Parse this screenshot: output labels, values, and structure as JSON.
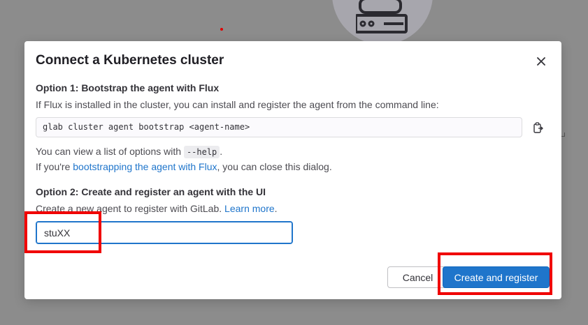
{
  "modal": {
    "title": "Connect a Kubernetes cluster",
    "close_icon": "close-icon",
    "option1": {
      "title": "Option 1: Bootstrap the agent with Flux",
      "description": "If Flux is installed in the cluster, you can install and register the agent from the command line:",
      "command": "glab cluster agent bootstrap <agent-name>",
      "copy_icon": "copy-to-clipboard-icon",
      "help_prefix": "You can view a list of options with ",
      "help_code": "--help",
      "help_suffix": ".",
      "flux_prefix": "If you're ",
      "flux_link": "bootstrapping the agent with Flux",
      "flux_suffix": ", you can close this dialog."
    },
    "option2": {
      "title": "Option 2: Create and register an agent with the UI",
      "description": "Create a new agent to register with GitLab. ",
      "learn_more": "Learn more",
      "learn_more_suffix": ".",
      "agent_name_value": "stuXX"
    },
    "buttons": {
      "cancel": "Cancel",
      "create": "Create and register"
    }
  },
  "colors": {
    "primary": "#1f75cb",
    "overlay": "#8c8c8c",
    "annotation": "#f00000"
  }
}
